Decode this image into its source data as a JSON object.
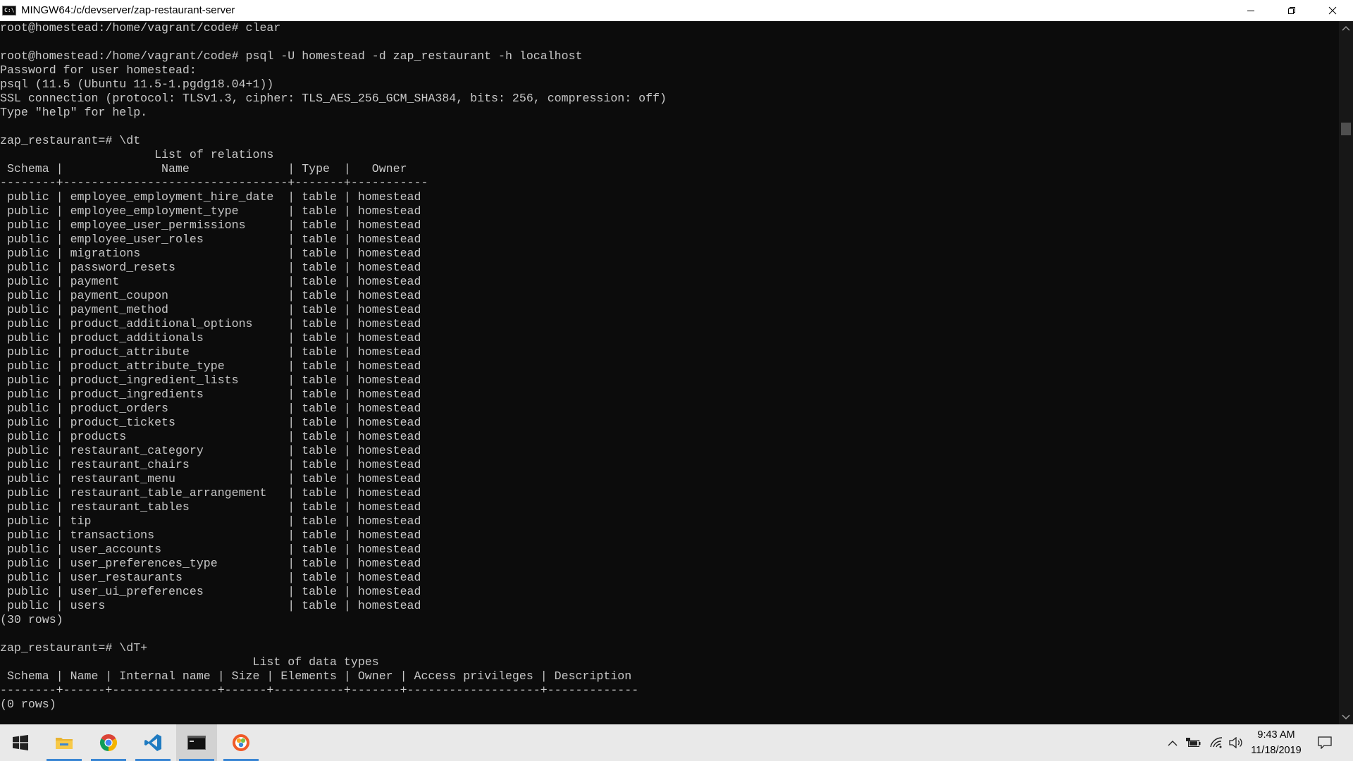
{
  "window": {
    "title": "MINGW64:/c/devserver/zap-restaurant-server",
    "icon": "terminal-icon",
    "buttons": [
      "minimize-icon",
      "restore-icon",
      "close-icon"
    ]
  },
  "console": {
    "lines": [
      "root@homestead:/home/vagrant/code# clear",
      "",
      "root@homestead:/home/vagrant/code# psql -U homestead -d zap_restaurant -h localhost",
      "Password for user homestead:",
      "psql (11.5 (Ubuntu 11.5-1.pgdg18.04+1))",
      "SSL connection (protocol: TLSv1.3, cipher: TLS_AES_256_GCM_SHA384, bits: 256, compression: off)",
      "Type \"help\" for help.",
      "",
      "zap_restaurant=# \\dt",
      "                      List of relations",
      " Schema |              Name              | Type  |   Owner",
      "--------+--------------------------------+-------+-----------",
      " public | employee_employment_hire_date  | table | homestead",
      " public | employee_employment_type       | table | homestead",
      " public | employee_user_permissions      | table | homestead",
      " public | employee_user_roles            | table | homestead",
      " public | migrations                     | table | homestead",
      " public | password_resets                | table | homestead",
      " public | payment                        | table | homestead",
      " public | payment_coupon                 | table | homestead",
      " public | payment_method                 | table | homestead",
      " public | product_additional_options     | table | homestead",
      " public | product_additionals            | table | homestead",
      " public | product_attribute              | table | homestead",
      " public | product_attribute_type         | table | homestead",
      " public | product_ingredient_lists       | table | homestead",
      " public | product_ingredients            | table | homestead",
      " public | product_orders                 | table | homestead",
      " public | product_tickets                | table | homestead",
      " public | products                       | table | homestead",
      " public | restaurant_category            | table | homestead",
      " public | restaurant_chairs              | table | homestead",
      " public | restaurant_menu                | table | homestead",
      " public | restaurant_table_arrangement   | table | homestead",
      " public | restaurant_tables              | table | homestead",
      " public | tip                            | table | homestead",
      " public | transactions                   | table | homestead",
      " public | user_accounts                  | table | homestead",
      " public | user_preferences_type          | table | homestead",
      " public | user_restaurants               | table | homestead",
      " public | user_ui_preferences            | table | homestead",
      " public | users                          | table | homestead",
      "(30 rows)",
      "",
      "zap_restaurant=# \\dT+",
      "                                    List of data types",
      " Schema | Name | Internal name | Size | Elements | Owner | Access privileges | Description",
      "--------+------+---------------+------+----------+-------+-------------------+-------------",
      "(0 rows)"
    ]
  },
  "scrollbar": {
    "up_icon": "scroll-up-arrow-icon",
    "down_icon": "scroll-down-arrow-icon"
  },
  "taskbar": {
    "apps": [
      {
        "icon": "windows-start-icon",
        "active": false,
        "open": false
      },
      {
        "icon": "file-explorer-icon",
        "active": false,
        "open": true
      },
      {
        "icon": "chrome-icon",
        "active": false,
        "open": true
      },
      {
        "icon": "vscode-icon",
        "active": false,
        "open": true
      },
      {
        "icon": "terminal-icon",
        "active": true,
        "open": true
      },
      {
        "icon": "app-circle-icon",
        "active": false,
        "open": true
      }
    ],
    "tray_icons": [
      "chevron-up-icon",
      "battery-icon",
      "wifi-icon",
      "volume-icon"
    ],
    "clock": {
      "time": "9:43 AM",
      "date": "11/18/2019"
    },
    "notification_icon": "notification-icon"
  }
}
